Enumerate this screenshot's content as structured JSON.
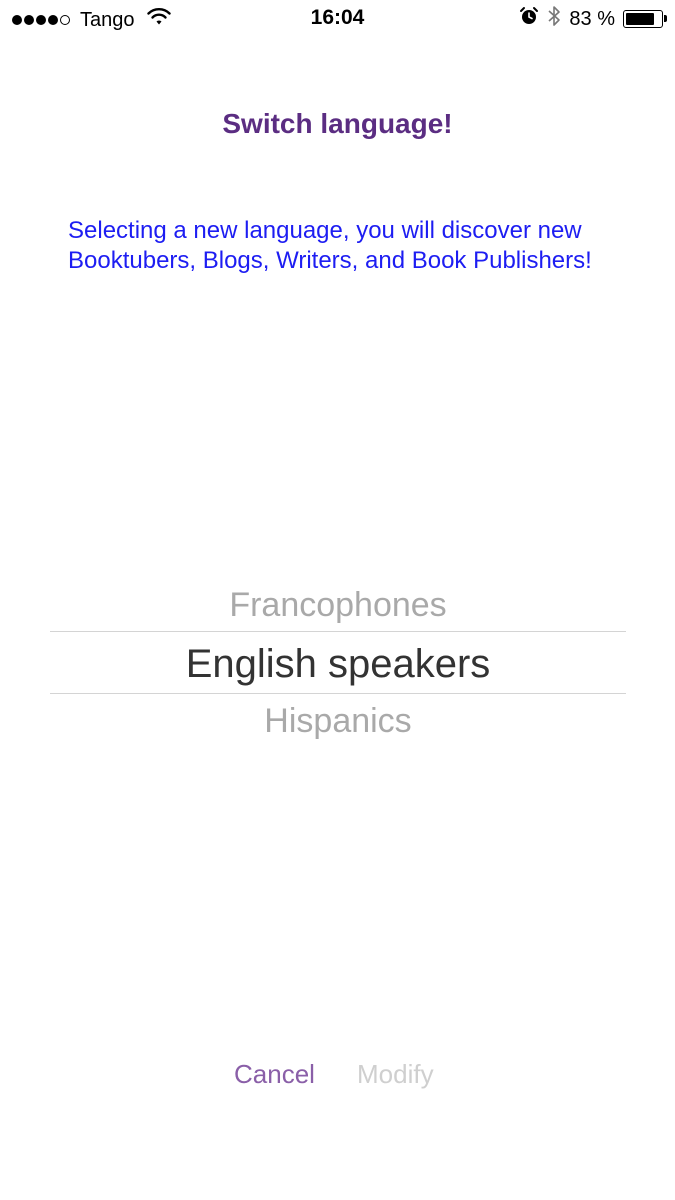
{
  "status_bar": {
    "carrier": "Tango",
    "signal_bars_filled": 4,
    "signal_bars_total": 5,
    "time": "16:04",
    "battery_percent": "83 %",
    "battery_level": 0.83,
    "icons": [
      "signal-icon",
      "wifi-icon",
      "alarm-icon",
      "bluetooth-icon",
      "battery-icon"
    ]
  },
  "title": "Switch language!",
  "description": "Selecting a new language, you will discover new Booktubers, Blogs, Writers, and Book Publishers!",
  "picker": {
    "options": [
      "Francophones",
      "English speakers",
      "Hispanics"
    ],
    "selected": "English speakers"
  },
  "actions": {
    "cancel_label": "Cancel",
    "modify_label": "Modify",
    "modify_enabled": false
  },
  "colors": {
    "title": "#5b2d82",
    "description": "#1d1df2",
    "cancel": "#8a5fa8",
    "modify_disabled": "#cfcfcf",
    "picker_selected": "#333333",
    "picker_unselected": "#a9a9a9"
  }
}
